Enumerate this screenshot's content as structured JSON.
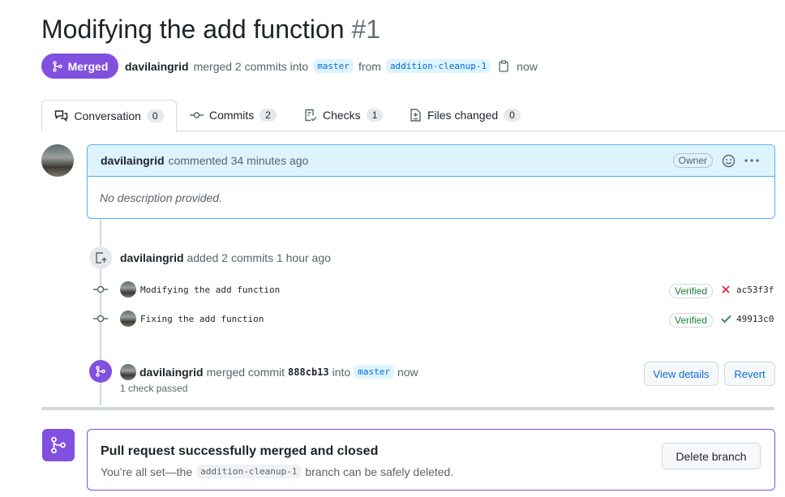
{
  "pr": {
    "title": "Modifying the add function",
    "number": "#1",
    "state": "Merged",
    "author": "davilaingrid",
    "merge_text": "merged 2 commits into",
    "base_branch": "master",
    "from_text": "from",
    "head_branch": "addition-cleanup-1",
    "when": "now"
  },
  "tabs": [
    {
      "label": "Conversation",
      "count": "0",
      "icon": "conversation-icon"
    },
    {
      "label": "Commits",
      "count": "2",
      "icon": "git-commit-icon"
    },
    {
      "label": "Checks",
      "count": "1",
      "icon": "checklist-icon"
    },
    {
      "label": "Files changed",
      "count": "0",
      "icon": "file-diff-icon"
    }
  ],
  "comment": {
    "author": "davilaingrid",
    "action": "commented 34 minutes ago",
    "badge": "Owner",
    "body": "No description provided."
  },
  "commits_event": {
    "author": "davilaingrid",
    "action": "added 2 commits 1 hour ago"
  },
  "commits": [
    {
      "message": "Modifying the add function",
      "verified": "Verified",
      "status": "failure",
      "sha": "ac53f3f"
    },
    {
      "message": "Fixing the add function",
      "verified": "Verified",
      "status": "success",
      "sha": "49913c0"
    }
  ],
  "merge_event": {
    "author": "davilaingrid",
    "text": "merged commit",
    "sha": "888cb13",
    "into": "into",
    "branch": "master",
    "when": "now",
    "checks": "1 check passed",
    "view_details": "View details",
    "revert": "Revert"
  },
  "merge_box": {
    "title": "Pull request successfully merged and closed",
    "before": "You’re all set—the",
    "branch": "addition-cleanup-1",
    "after": "branch can be safely deleted.",
    "delete_button": "Delete branch"
  },
  "colors": {
    "merged": "#8250df",
    "link": "#0969da",
    "success": "#1a7f37",
    "danger": "#d1242f"
  }
}
